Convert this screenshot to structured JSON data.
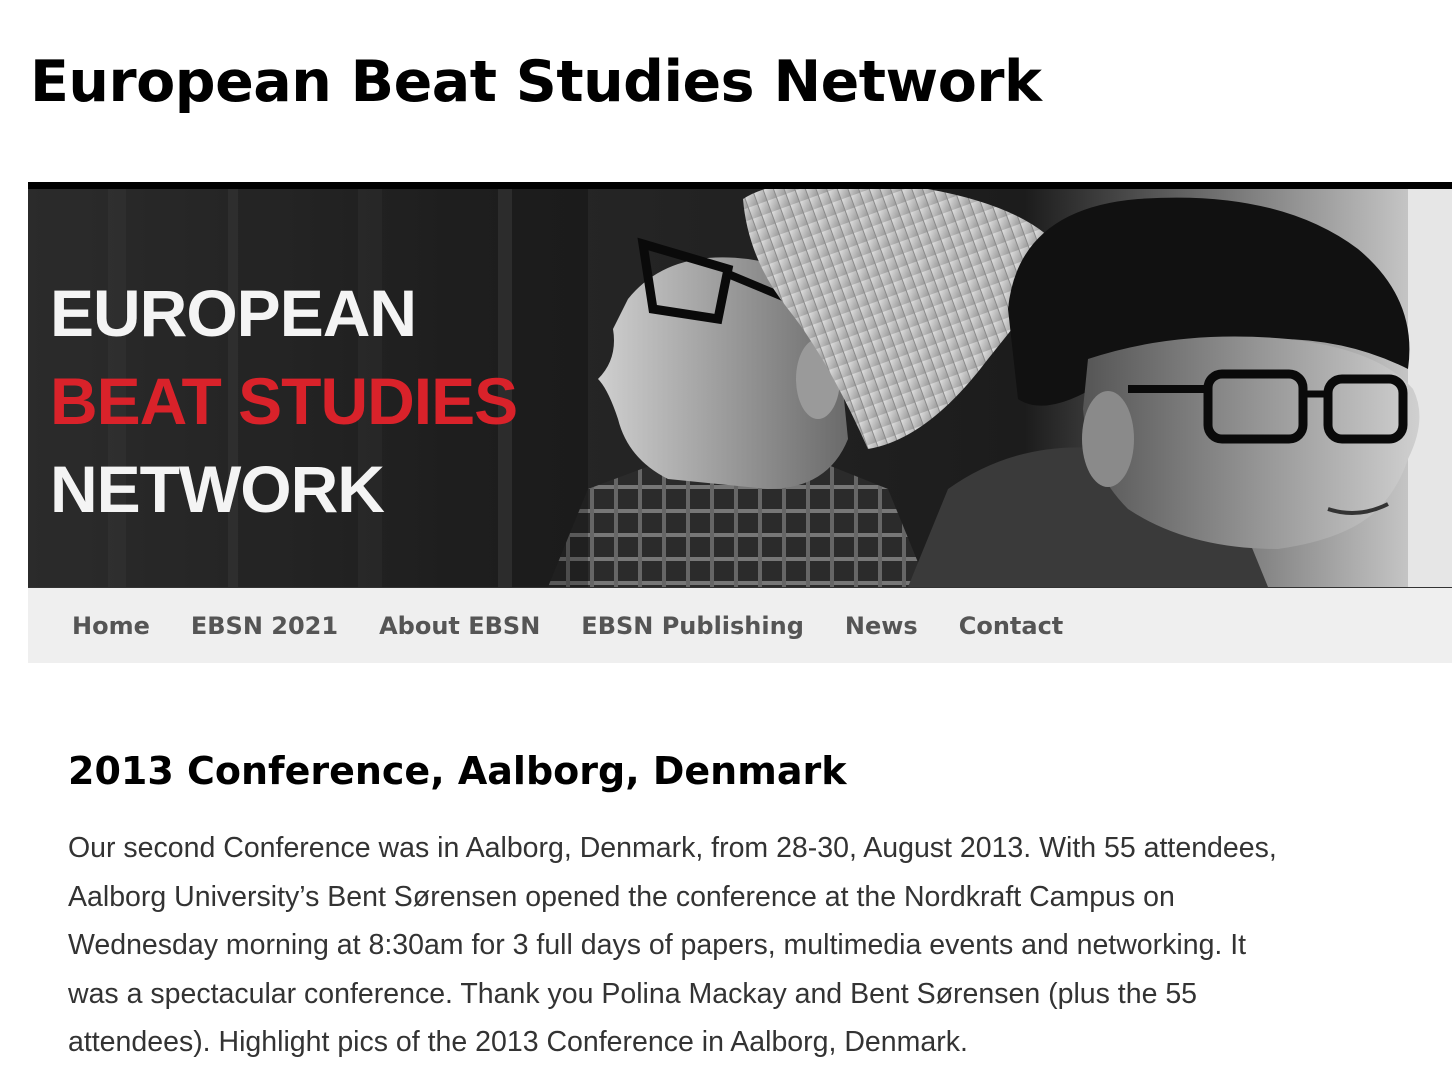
{
  "site": {
    "title": "European Beat Studies Network"
  },
  "banner": {
    "line1": "EUROPEAN",
    "line2": "BEAT STUDIES",
    "line3": "NETWORK",
    "accent_color": "#d9222a"
  },
  "nav": {
    "items": [
      {
        "label": "Home"
      },
      {
        "label": "EBSN 2021"
      },
      {
        "label": "About EBSN"
      },
      {
        "label": "EBSN Publishing"
      },
      {
        "label": "News"
      },
      {
        "label": "Contact"
      }
    ]
  },
  "post": {
    "title": "2013 Conference, Aalborg, Denmark",
    "body_lines": [
      "Our second Conference was in Aalborg, Denmark, from 28-30, August 2013. With 55 attendees,",
      "Aalborg University’s Bent Sørensen opened the conference at the Nordkraft Campus on",
      "Wednesday morning at 8:30am for 3 full days of papers, multimedia events and networking. It",
      "was a spectacular conference. Thank you Polina Mackay and Bent Sørensen (plus the 55",
      "attendees). Highlight pics of the 2013 Conference in Aalborg, Denmark."
    ]
  }
}
